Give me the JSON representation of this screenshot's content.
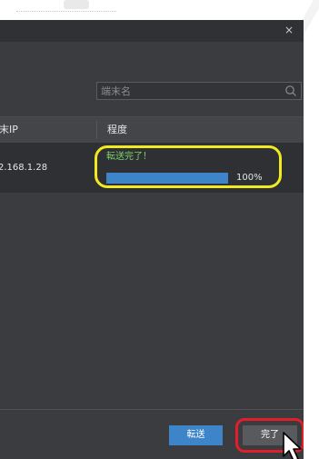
{
  "dialog": {
    "close_symbol": "×"
  },
  "search": {
    "placeholder": "端末名",
    "icon": "search-icon"
  },
  "table": {
    "columns": [
      "末IP",
      "程度"
    ],
    "rows": [
      {
        "ip": "2.168.1.28",
        "status": "転送完了！",
        "progress_percent": 100,
        "progress_label": "100%"
      }
    ]
  },
  "footer": {
    "send_label": "転送",
    "done_label": "完了"
  },
  "colors": {
    "accent": "#3d84c9",
    "success_text": "#7bd36b",
    "highlight_yellow": "#f1ea22",
    "highlight_red": "#e21e2b",
    "dialog_bg": "#3a3c40"
  },
  "icons": [
    "close-icon",
    "search-icon",
    "mouse-pointer-icon"
  ]
}
